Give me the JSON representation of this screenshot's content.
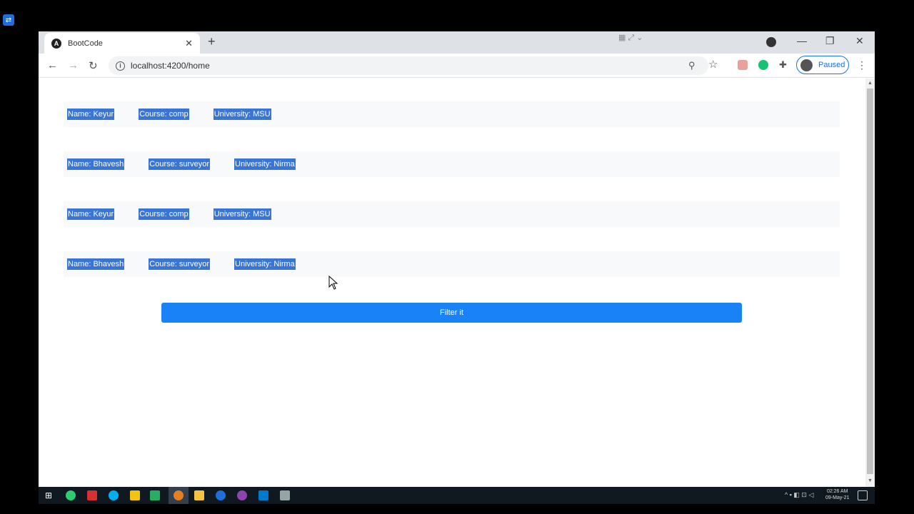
{
  "browser": {
    "tab_title": "BootCode",
    "tab_favicon": "A",
    "url": "localhost:4200/home",
    "profile_label": "Paused"
  },
  "icons": {
    "close": "✕",
    "new_tab": "+",
    "back": "←",
    "forward": "→",
    "reload": "↻",
    "info": "i",
    "zoom": "⚲",
    "bookmark": "☆",
    "extensions": "✚",
    "menu": "⋮",
    "minimize": "—",
    "restore": "❐",
    "window_close": "✕",
    "tray": "^ ▪ ◧ ⊡ ◁"
  },
  "records": [
    {
      "name": "Name: Keyur",
      "course": "Course: comp",
      "university": "University: MSU"
    },
    {
      "name": "Name: Bhavesh",
      "course": "Course: surveyor",
      "university": "University: Nirma"
    },
    {
      "name": "Name: Keyur",
      "course": "Course: comp",
      "university": "University: MSU"
    },
    {
      "name": "Name: Bhavesh",
      "course": "Course: surveyor",
      "university": "University: Nirma"
    }
  ],
  "filter_button_label": "Filter it",
  "taskbar": {
    "time": "02:26 AM",
    "date": "09-May-21"
  },
  "colors": {
    "selection": "#3875d7",
    "button": "#1a82f7",
    "row_bg": "#f8f9fa"
  }
}
